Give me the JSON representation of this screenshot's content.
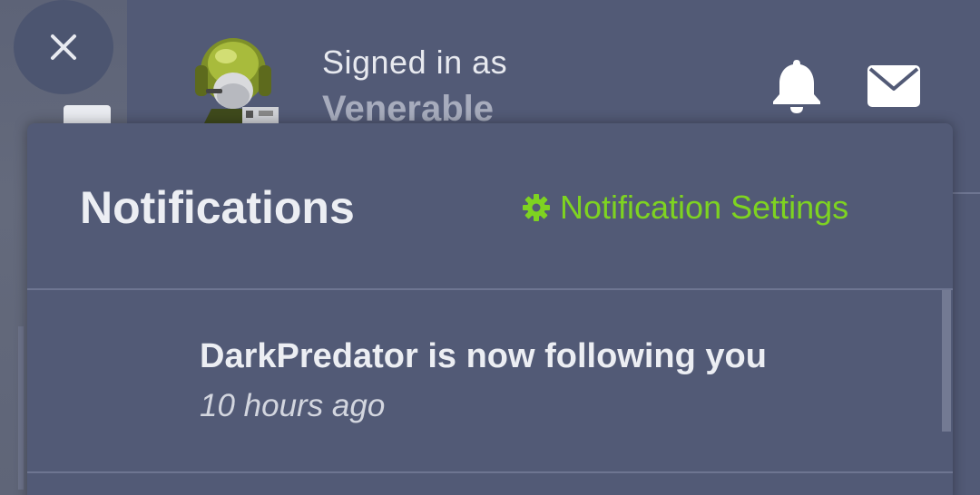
{
  "header": {
    "signed_in_label": "Signed in as",
    "username": "Venerable",
    "close_icon": "close-icon",
    "bell_icon": "bell-icon",
    "mail_icon": "mail-icon"
  },
  "notifications": {
    "title": "Notifications",
    "settings_label": "Notification Settings",
    "settings_icon": "gear-icon",
    "accent_color": "#7ed321",
    "items": [
      {
        "text": "DarkPredator is now following you",
        "time": "10 hours ago"
      }
    ]
  }
}
